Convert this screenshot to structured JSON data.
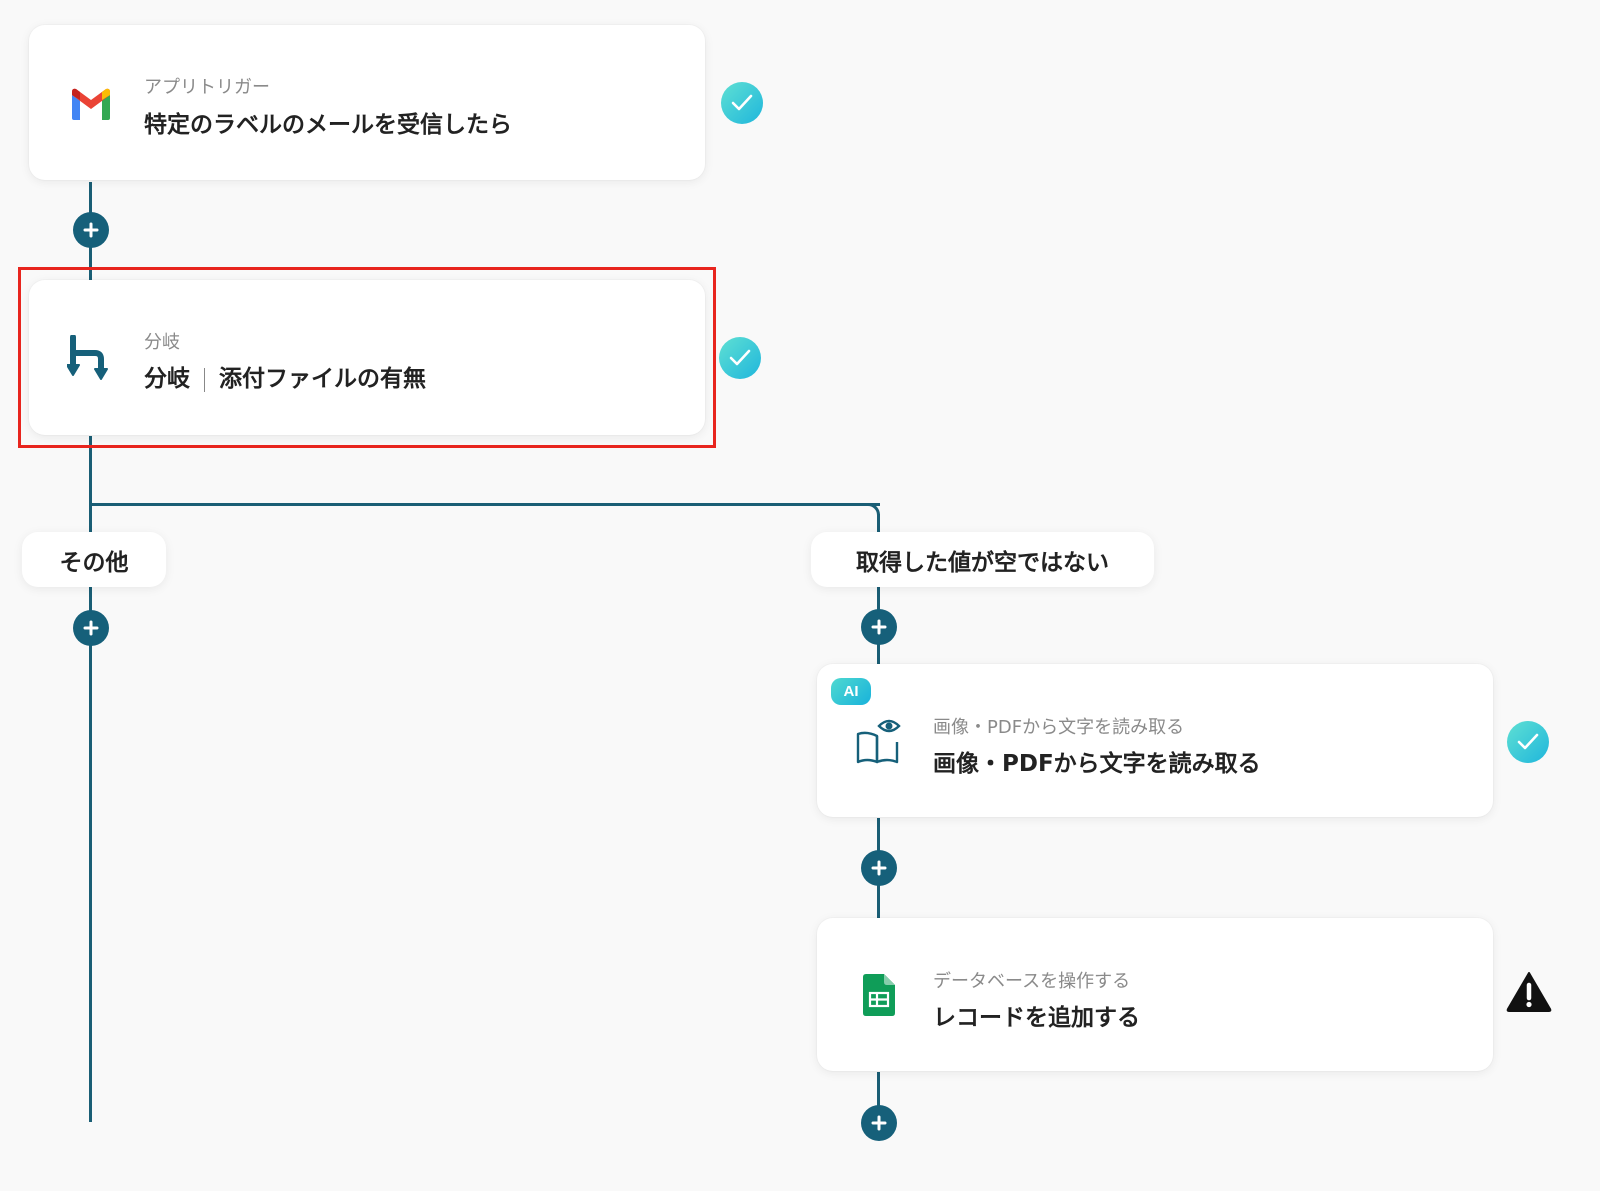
{
  "steps": {
    "trigger": {
      "subtitle": "アプリトリガー",
      "title": "特定のラベルのメールを受信したら",
      "icon": "gmail-icon",
      "status": "complete"
    },
    "branch": {
      "subtitle": "分岐",
      "title_part1": "分岐",
      "title_part2": "添付ファイルの有無",
      "icon": "branch-icon",
      "status": "complete",
      "highlighted": true
    },
    "ocr": {
      "badge": "AI",
      "subtitle": "画像・PDFから文字を読み取る",
      "title": "画像・PDFから文字を読み取る",
      "icon": "book-eye-icon",
      "status": "complete"
    },
    "sheet": {
      "subtitle": "データベースを操作する",
      "title": "レコードを追加する",
      "icon": "google-sheets-icon",
      "status": "warning"
    }
  },
  "branches": {
    "other_label": "その他",
    "not_empty_label": "取得した値が空ではない"
  },
  "colors": {
    "connector": "#1a5e75",
    "add_button": "#16607a",
    "check": "#1fb6dc",
    "highlight": "#e8251e",
    "warning": "#111111"
  }
}
